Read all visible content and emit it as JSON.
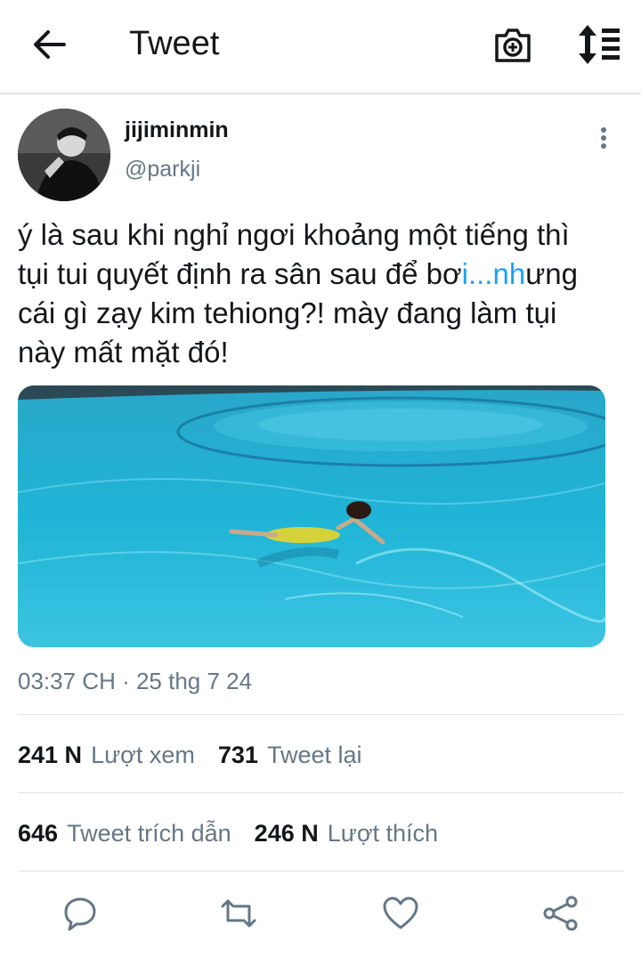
{
  "header": {
    "title": "Tweet",
    "icons": [
      "back-arrow-icon",
      "camera-plus-icon",
      "sort-list-icon"
    ]
  },
  "tweet": {
    "display_name": "jijiminmin",
    "handle": "@parkji",
    "text_lines": [
      "ý là sau khi nghỉ ngơi khoảng một tiếng thì",
      "tụi tui quyết định ra sân sau để bơ",
      "i...nh",
      "ưng",
      "cái gì zạy kim tehiong?! mày đang làm tụi",
      "này mất mặt đó!"
    ],
    "timestamp": "03:37 CH · 25 thg 7 24"
  },
  "stats": {
    "views_count": "241 N",
    "views_label": "Lượt xem",
    "retweets_count": "731",
    "retweets_label": "Tweet lại",
    "quotes_count": "646",
    "quotes_label": "Tweet trích dẫn",
    "likes_count": "246 N",
    "likes_label": "Lượt thích"
  },
  "actions": [
    "reply-icon",
    "retweet-icon",
    "like-icon",
    "share-icon"
  ],
  "colors": {
    "link": "#1da1f2",
    "secondary_text": "#657786",
    "primary_text": "#14171a",
    "divider": "#e1e4e6",
    "pool_water": "#1fb4d6"
  }
}
